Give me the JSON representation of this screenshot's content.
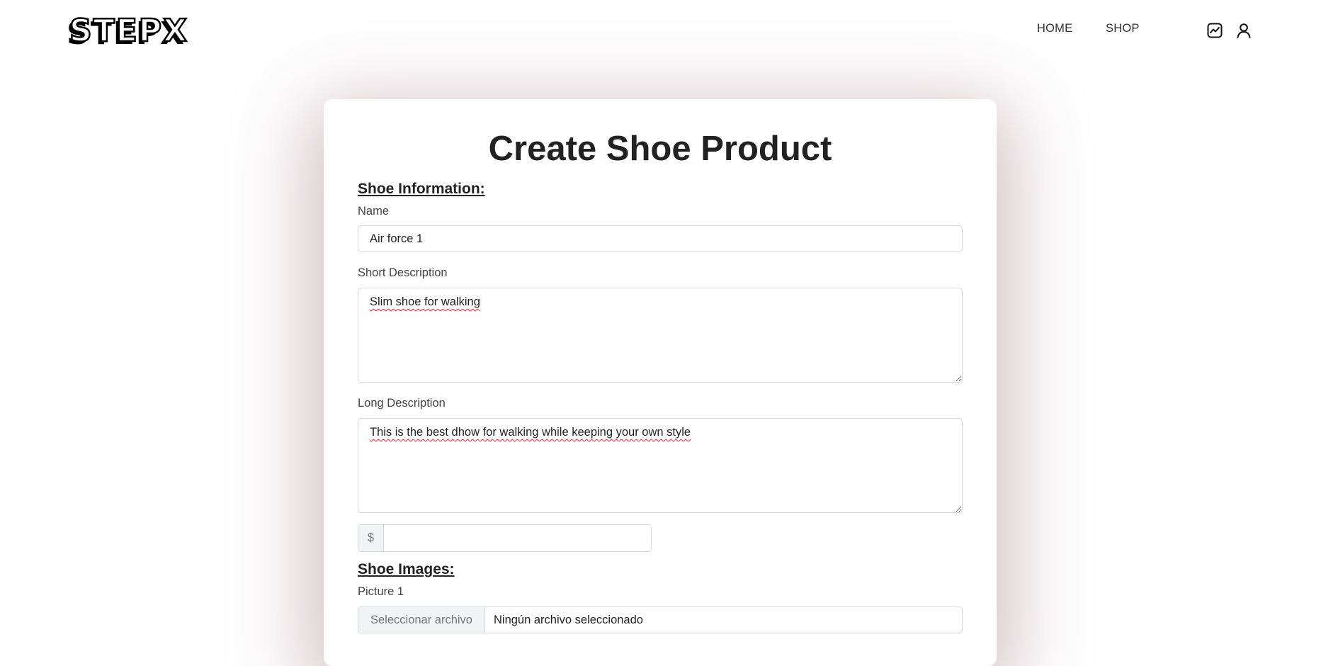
{
  "header": {
    "logo": "STEPX",
    "nav": {
      "home": "HOME",
      "shop": "SHOP"
    },
    "icons": [
      "chart-icon",
      "user-icon"
    ]
  },
  "form": {
    "title": "Create Shoe Product",
    "section_info": "Shoe Information:",
    "name_label": "Name",
    "name_value": "Air force 1",
    "short_desc_label": "Short Description",
    "short_desc_value": "Slim shoe for walking",
    "long_desc_label": "Long Description",
    "long_desc_value": "This is the best dhow for walking while keeping your own style",
    "price_prefix": "$",
    "price_value": "",
    "section_images": "Shoe Images:",
    "picture1_label": "Picture 1",
    "file_button": "Seleccionar archivo",
    "file_status": "Ningún archivo seleccionado"
  }
}
